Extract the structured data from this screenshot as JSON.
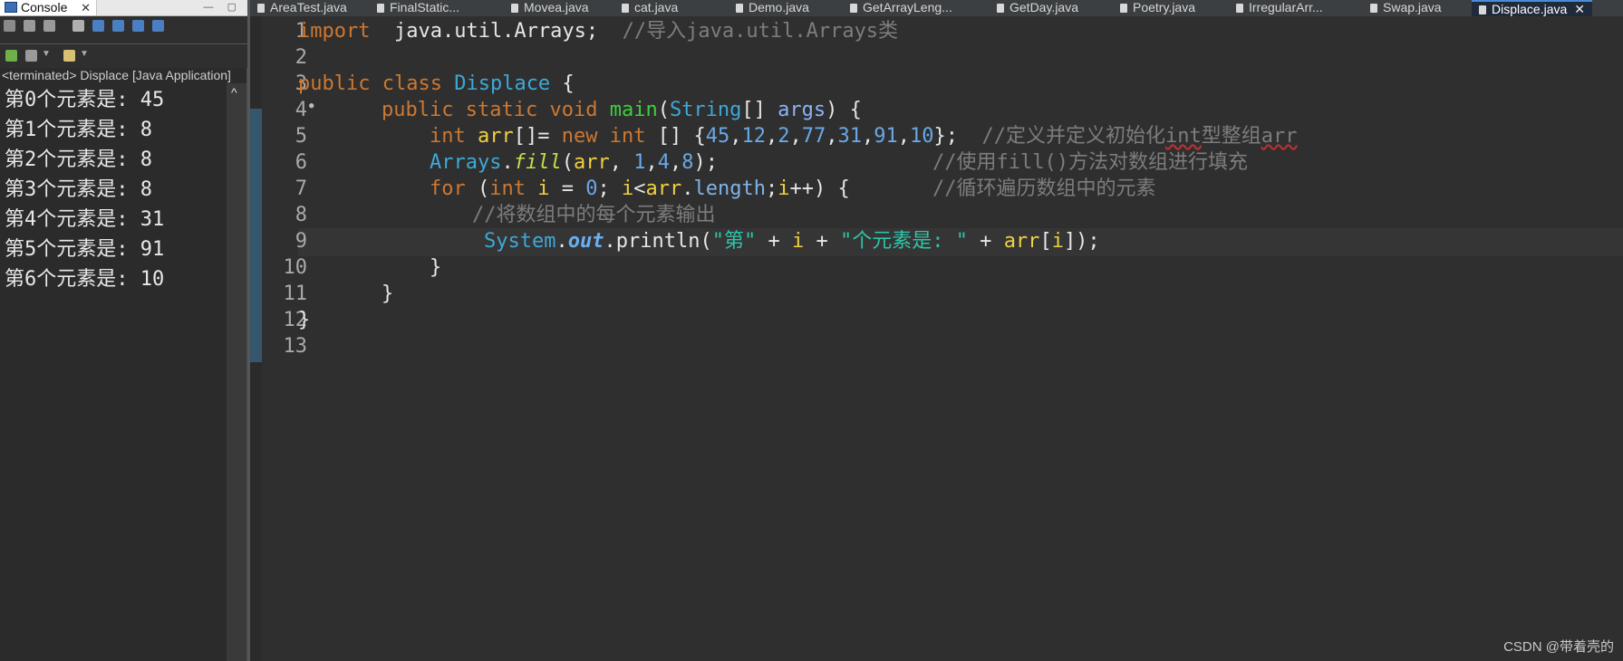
{
  "console": {
    "tab_label": "Console",
    "status": "<terminated> Displace [Java Application]",
    "output": [
      "第0个元素是: 45",
      "第1个元素是: 8",
      "第2个元素是: 8",
      "第3个元素是: 8",
      "第4个元素是: 31",
      "第5个元素是: 91",
      "第6个元素是: 10"
    ]
  },
  "editor": {
    "tabs": [
      {
        "label": "AreaTest.java",
        "active": false
      },
      {
        "label": "FinalStatic...",
        "active": false
      },
      {
        "label": "Movea.java",
        "active": false
      },
      {
        "label": "cat.java",
        "active": false
      },
      {
        "label": "Demo.java",
        "active": false
      },
      {
        "label": "GetArrayLeng...",
        "active": false
      },
      {
        "label": "GetDay.java",
        "active": false
      },
      {
        "label": "Poetry.java",
        "active": false
      },
      {
        "label": "IrregularArr...",
        "active": false
      },
      {
        "label": "Swap.java",
        "active": false
      },
      {
        "label": "Displace.java",
        "active": true
      }
    ],
    "line_numbers": [
      "1",
      "2",
      "3",
      "4",
      "5",
      "6",
      "7",
      "8",
      "9",
      "10",
      "11",
      "12",
      "13"
    ],
    "code": {
      "l1_kw": "import",
      "l1_pkg": " java.util.Arrays;  ",
      "l1_comment": "//导入java.util.Arrays类",
      "l3_kw1": "public",
      "l3_kw2": "class",
      "l3_cls": "Displace",
      "l3_rest": " {",
      "l4_kw1": "public",
      "l4_kw2": "static",
      "l4_kw3": "void",
      "l4_fn": "main",
      "l4_p1": "(",
      "l4_type": "String",
      "l4_p2": "[] ",
      "l4_arg": "args",
      "l4_p3": ") {",
      "l5_kw1": "int",
      "l5_var": "arr",
      "l5_p1": "[]= ",
      "l5_kw2": "new",
      "l5_kw3": "int",
      "l5_p2": " [] {",
      "l5_n1": "45",
      "l5_n2": "12",
      "l5_n3": "2",
      "l5_n4": "77",
      "l5_n5": "31",
      "l5_n6": "91",
      "l5_n7": "10",
      "l5_p3": "};  ",
      "l5_comment_a": "//定义并定义初始化",
      "l5_comment_b": "int",
      "l5_comment_c": "型整组",
      "l5_comment_d": "arr",
      "l6_cls": "Arrays",
      "l6_dot": ".",
      "l6_fn": "fill",
      "l6_p1": "(",
      "l6_var": "arr",
      "l6_p2": ", ",
      "l6_n1": "1",
      "l6_n2": "4",
      "l6_n3": "8",
      "l6_p3": ");",
      "l6_comment": "//使用fill()方法对数组进行填充",
      "l7_kw": "for",
      "l7_p1": " (",
      "l7_kw2": "int",
      "l7_var": " i",
      "l7_p2": " = ",
      "l7_n": "0",
      "l7_p3": "; ",
      "l7_var2": "i",
      "l7_p4": "<",
      "l7_var3": "arr",
      "l7_p5": ".",
      "l7_fld": "length",
      "l7_p6": ";",
      "l7_var4": "i",
      "l7_p7": "++) {",
      "l7_comment": "//循环遍历数组中的元素",
      "l8_comment": "//将数组中的每个元素输出",
      "l9_cls": "System",
      "l9_dot": ".",
      "l9_out": "out",
      "l9_p1": ".println(",
      "l9_s1": "\"第\"",
      "l9_p2": " + ",
      "l9_var": "i",
      "l9_p3": " + ",
      "l9_s2": "\"个元素是: \"",
      "l9_p4": " + ",
      "l9_var2": "arr",
      "l9_p5": "[",
      "l9_var3": "i",
      "l9_p6": "]);",
      "l10": "}",
      "l11": "}",
      "l12": "}"
    }
  },
  "watermark": "CSDN @带着壳的"
}
